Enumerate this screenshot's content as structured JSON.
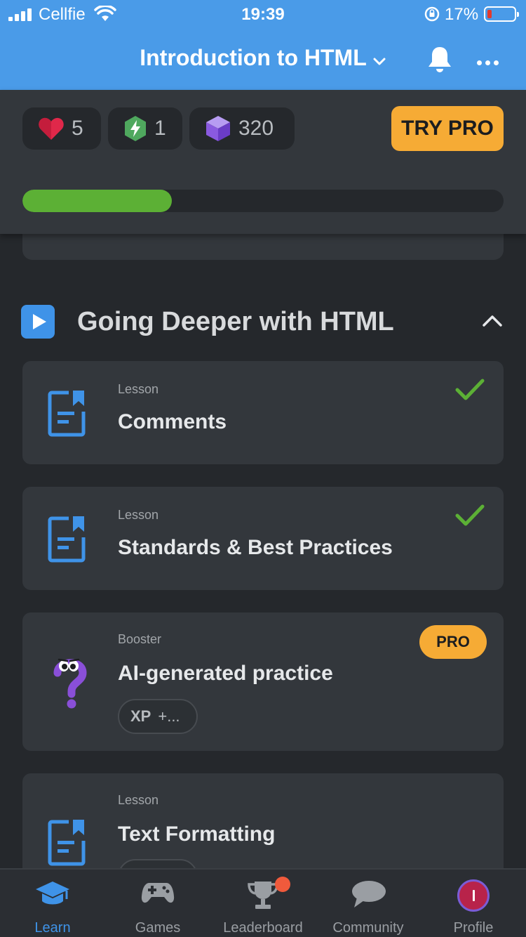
{
  "status_bar": {
    "carrier": "Cellfie",
    "time": "19:39",
    "battery_percent": "17%",
    "battery_level": 0.17
  },
  "header": {
    "course_title": "Introduction to HTML",
    "dropdown_icon": "chevron-down-icon",
    "bell_icon": "bell-icon",
    "more_icon": "more-horizontal-icon"
  },
  "stats": {
    "hearts": "5",
    "energy": "1",
    "gems": "320",
    "try_pro_label": "TRY PRO"
  },
  "progress": {
    "value": 0.31,
    "color": "#5cb035"
  },
  "section": {
    "title": "Going Deeper with HTML",
    "icon": "play-icon",
    "collapse_icon": "chevron-up-icon"
  },
  "items": [
    {
      "type": "Lesson",
      "title": "Comments",
      "completed": true,
      "icon": "lesson-document-icon"
    },
    {
      "type": "Lesson",
      "title": "Standards & Best Practices",
      "completed": true,
      "icon": "lesson-document-icon"
    },
    {
      "type": "Booster",
      "title": "AI-generated practice",
      "badge": "PRO",
      "xp_label": "XP",
      "xp_value": "+...",
      "icon": "question-mark-mascot-icon"
    },
    {
      "type": "Lesson",
      "title": "Text Formatting",
      "completed": false,
      "icon": "lesson-document-icon"
    }
  ],
  "bottom_nav": [
    {
      "label": "Learn",
      "icon": "graduation-cap-icon",
      "active": true
    },
    {
      "label": "Games",
      "icon": "gamepad-icon",
      "active": false
    },
    {
      "label": "Leaderboard",
      "icon": "trophy-icon",
      "active": false,
      "notification": true
    },
    {
      "label": "Community",
      "icon": "chat-bubble-icon",
      "active": false
    },
    {
      "label": "Profile",
      "icon": "avatar-icon",
      "active": false
    }
  ],
  "colors": {
    "header_bg": "#4a9be8",
    "accent_blue": "#3f93e8",
    "pro_orange": "#f6ab35",
    "success_green": "#5cb035",
    "card_bg": "#33373c",
    "page_bg": "#25282c"
  }
}
